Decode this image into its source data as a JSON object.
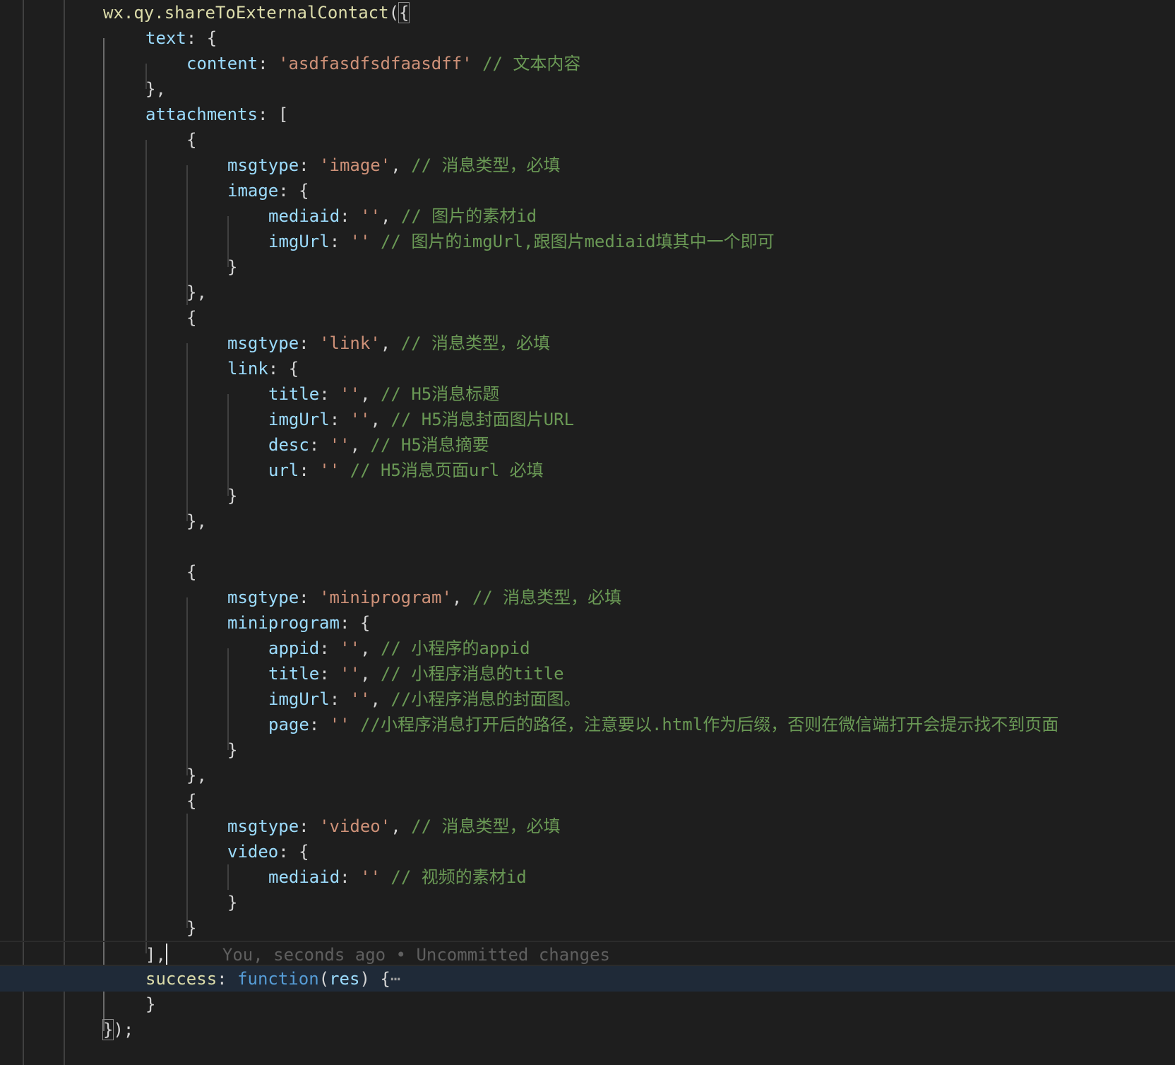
{
  "editor": {
    "lines": [
      {
        "id": "l1",
        "tokens": [
          [
            "f",
            "wx.qy.shareToExternalContact"
          ],
          [
            "p",
            "("
          ],
          [
            "p",
            "{"
          ]
        ]
      },
      {
        "id": "l2",
        "tokens": [
          [
            "k",
            "text"
          ],
          [
            "p",
            ": {"
          ]
        ]
      },
      {
        "id": "l3",
        "tokens": [
          [
            "k",
            "content"
          ],
          [
            "p",
            ": "
          ],
          [
            "s",
            "'asdfasdfsdfaasdff'"
          ],
          [
            "p",
            " "
          ],
          [
            "c",
            "// 文本内容"
          ]
        ]
      },
      {
        "id": "l4",
        "tokens": [
          [
            "p",
            "},"
          ]
        ]
      },
      {
        "id": "l5",
        "tokens": [
          [
            "k",
            "attachments"
          ],
          [
            "p",
            ": ["
          ]
        ]
      },
      {
        "id": "l6",
        "tokens": [
          [
            "p",
            "{"
          ]
        ]
      },
      {
        "id": "l7",
        "tokens": [
          [
            "k",
            "msgtype"
          ],
          [
            "p",
            ": "
          ],
          [
            "s",
            "'image'"
          ],
          [
            "p",
            ", "
          ],
          [
            "c",
            "// 消息类型，必填"
          ]
        ]
      },
      {
        "id": "l8",
        "tokens": [
          [
            "k",
            "image"
          ],
          [
            "p",
            ": {"
          ]
        ]
      },
      {
        "id": "l9",
        "tokens": [
          [
            "k",
            "mediaid"
          ],
          [
            "p",
            ": "
          ],
          [
            "s",
            "''"
          ],
          [
            "p",
            ", "
          ],
          [
            "c",
            "// 图片的素材id"
          ]
        ]
      },
      {
        "id": "l10",
        "tokens": [
          [
            "k",
            "imgUrl"
          ],
          [
            "p",
            ": "
          ],
          [
            "s",
            "''"
          ],
          [
            "p",
            " "
          ],
          [
            "c",
            "// 图片的imgUrl,跟图片mediaid填其中一个即可"
          ]
        ]
      },
      {
        "id": "l11",
        "tokens": [
          [
            "p",
            "}"
          ]
        ]
      },
      {
        "id": "l12",
        "tokens": [
          [
            "p",
            "},"
          ]
        ]
      },
      {
        "id": "l13",
        "tokens": [
          [
            "p",
            "{"
          ]
        ]
      },
      {
        "id": "l14",
        "tokens": [
          [
            "k",
            "msgtype"
          ],
          [
            "p",
            ": "
          ],
          [
            "s",
            "'link'"
          ],
          [
            "p",
            ", "
          ],
          [
            "c",
            "// 消息类型，必填"
          ]
        ]
      },
      {
        "id": "l15",
        "tokens": [
          [
            "k",
            "link"
          ],
          [
            "p",
            ": {"
          ]
        ]
      },
      {
        "id": "l16",
        "tokens": [
          [
            "k",
            "title"
          ],
          [
            "p",
            ": "
          ],
          [
            "s",
            "''"
          ],
          [
            "p",
            ", "
          ],
          [
            "c",
            "// H5消息标题"
          ]
        ]
      },
      {
        "id": "l17",
        "tokens": [
          [
            "k",
            "imgUrl"
          ],
          [
            "p",
            ": "
          ],
          [
            "s",
            "''"
          ],
          [
            "p",
            ", "
          ],
          [
            "c",
            "// H5消息封面图片URL"
          ]
        ]
      },
      {
        "id": "l18",
        "tokens": [
          [
            "k",
            "desc"
          ],
          [
            "p",
            ": "
          ],
          [
            "s",
            "''"
          ],
          [
            "p",
            ", "
          ],
          [
            "c",
            "// H5消息摘要"
          ]
        ]
      },
      {
        "id": "l19",
        "tokens": [
          [
            "k",
            "url"
          ],
          [
            "p",
            ": "
          ],
          [
            "s",
            "''"
          ],
          [
            "p",
            " "
          ],
          [
            "c",
            "// H5消息页面url 必填"
          ]
        ]
      },
      {
        "id": "l20",
        "tokens": [
          [
            "p",
            "}"
          ]
        ]
      },
      {
        "id": "l21",
        "tokens": [
          [
            "p",
            "},"
          ]
        ]
      },
      {
        "id": "l22",
        "tokens": []
      },
      {
        "id": "l23",
        "tokens": [
          [
            "p",
            "{"
          ]
        ]
      },
      {
        "id": "l24",
        "tokens": [
          [
            "k",
            "msgtype"
          ],
          [
            "p",
            ": "
          ],
          [
            "s",
            "'miniprogram'"
          ],
          [
            "p",
            ", "
          ],
          [
            "c",
            "// 消息类型，必填"
          ]
        ]
      },
      {
        "id": "l25",
        "tokens": [
          [
            "k",
            "miniprogram"
          ],
          [
            "p",
            ": {"
          ]
        ]
      },
      {
        "id": "l26",
        "tokens": [
          [
            "k",
            "appid"
          ],
          [
            "p",
            ": "
          ],
          [
            "s",
            "''"
          ],
          [
            "p",
            ", "
          ],
          [
            "c",
            "// 小程序的appid"
          ]
        ]
      },
      {
        "id": "l27",
        "tokens": [
          [
            "k",
            "title"
          ],
          [
            "p",
            ": "
          ],
          [
            "s",
            "''"
          ],
          [
            "p",
            ", "
          ],
          [
            "c",
            "// 小程序消息的title"
          ]
        ]
      },
      {
        "id": "l28",
        "tokens": [
          [
            "k",
            "imgUrl"
          ],
          [
            "p",
            ": "
          ],
          [
            "s",
            "''"
          ],
          [
            "p",
            ", "
          ],
          [
            "c",
            "//小程序消息的封面图。"
          ]
        ]
      },
      {
        "id": "l29",
        "tokens": [
          [
            "k",
            "page"
          ],
          [
            "p",
            ": "
          ],
          [
            "s",
            "''"
          ],
          [
            "p",
            " "
          ],
          [
            "c",
            "//小程序消息打开后的路径，注意要以.html作为后缀，否则在微信端打开会提示找不到页面"
          ]
        ]
      },
      {
        "id": "l30",
        "tokens": [
          [
            "p",
            "}"
          ]
        ]
      },
      {
        "id": "l31",
        "tokens": [
          [
            "p",
            "},"
          ]
        ]
      },
      {
        "id": "l32",
        "tokens": [
          [
            "p",
            "{"
          ]
        ]
      },
      {
        "id": "l33",
        "tokens": [
          [
            "k",
            "msgtype"
          ],
          [
            "p",
            ": "
          ],
          [
            "s",
            "'video'"
          ],
          [
            "p",
            ", "
          ],
          [
            "c",
            "// 消息类型，必填"
          ]
        ]
      },
      {
        "id": "l34",
        "tokens": [
          [
            "k",
            "video"
          ],
          [
            "p",
            ": {"
          ]
        ]
      },
      {
        "id": "l35",
        "tokens": [
          [
            "k",
            "mediaid"
          ],
          [
            "p",
            ": "
          ],
          [
            "s",
            "''"
          ],
          [
            "p",
            " "
          ],
          [
            "c",
            "// 视频的素材id"
          ]
        ]
      },
      {
        "id": "l36",
        "tokens": [
          [
            "p",
            "}"
          ]
        ]
      },
      {
        "id": "l37",
        "tokens": [
          [
            "p",
            "}"
          ]
        ]
      },
      {
        "id": "l38",
        "tokens": [
          [
            "p",
            "],"
          ]
        ]
      },
      {
        "id": "l39",
        "tokens": [
          [
            "f",
            "success"
          ],
          [
            "p",
            ": "
          ],
          [
            "kw",
            "function"
          ],
          [
            "p",
            "("
          ],
          [
            "prm",
            "res"
          ],
          [
            "p",
            ") {"
          ]
        ]
      },
      {
        "id": "l40",
        "tokens": [
          [
            "p",
            "}"
          ]
        ]
      },
      {
        "id": "l41",
        "tokens": [
          [
            "p",
            "}"
          ],
          [
            "p",
            ");"
          ]
        ]
      }
    ],
    "git_blame": "You, seconds ago • Uncommitted changes",
    "fold_ellipsis": "⋯"
  },
  "colors": {
    "background": "#1e1e1e",
    "property": "#9cdcfe",
    "function": "#dcdcaa",
    "string": "#ce9178",
    "comment": "#6a9955",
    "keyword": "#569cd6",
    "current_line": "#1f2a38"
  }
}
